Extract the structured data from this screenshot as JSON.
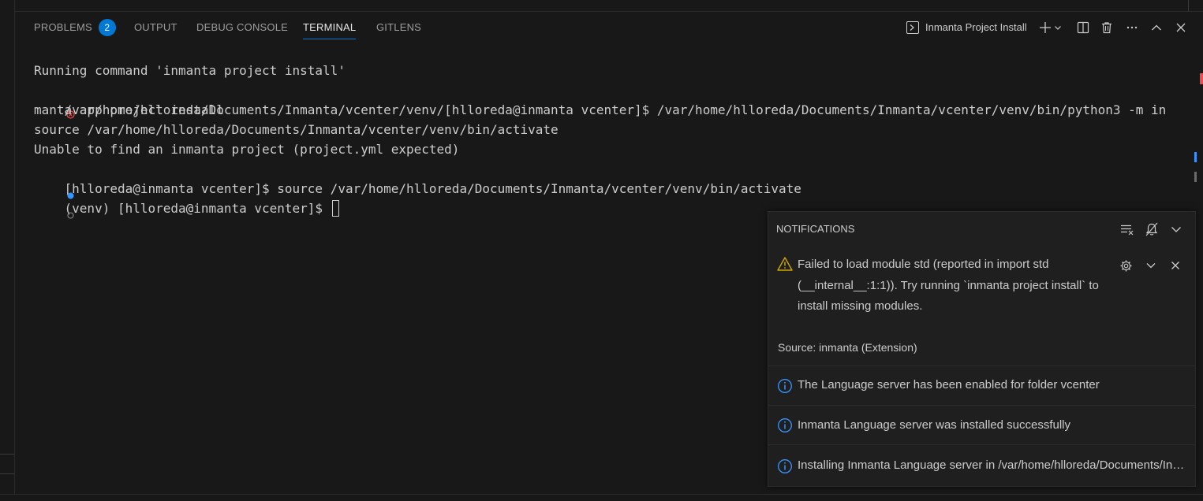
{
  "panel": {
    "tabs": [
      {
        "label": "PROBLEMS",
        "badge": "2"
      },
      {
        "label": "OUTPUT"
      },
      {
        "label": "DEBUG CONSOLE"
      },
      {
        "label": "TERMINAL"
      },
      {
        "label": "GITLENS"
      }
    ],
    "terminal_name": "Inmanta Project Install"
  },
  "terminal": {
    "lines": [
      "Running command 'inmanta project install'",
      "/var/home/hlloreda/Documents/Inmanta/vcenter/venv/[hlloreda@inmanta vcenter]$ /var/home/hlloreda/Documents/Inmanta/vcenter/venv/bin/python3 -m in",
      "manta.app project install",
      "source /var/home/hlloreda/Documents/Inmanta/vcenter/venv/bin/activate",
      "Unable to find an inmanta project (project.yml expected)",
      "[hlloreda@inmanta vcenter]$ source /var/home/hlloreda/Documents/Inmanta/vcenter/venv/bin/activate",
      "(venv) [hlloreda@inmanta vcenter]$ "
    ]
  },
  "notifications": {
    "title": "NOTIFICATIONS",
    "warning": {
      "line1": "Failed to load module std (reported in import std",
      "line2": "(__internal__:1:1)). Try running `inmanta project install` to",
      "line3": "install missing modules.",
      "source": "Source: inmanta (Extension)"
    },
    "info": [
      "The Language server has been enabled for folder vcenter",
      "Inmanta Language server was installed successfully",
      "Installing Inmanta Language server in /var/home/hlloreda/Documents/Inmanta/vcenter/venv"
    ]
  },
  "colors": {
    "accent": "#0078d4",
    "error": "#f14c4c",
    "warning": "#cca700",
    "info": "#3794ff"
  }
}
